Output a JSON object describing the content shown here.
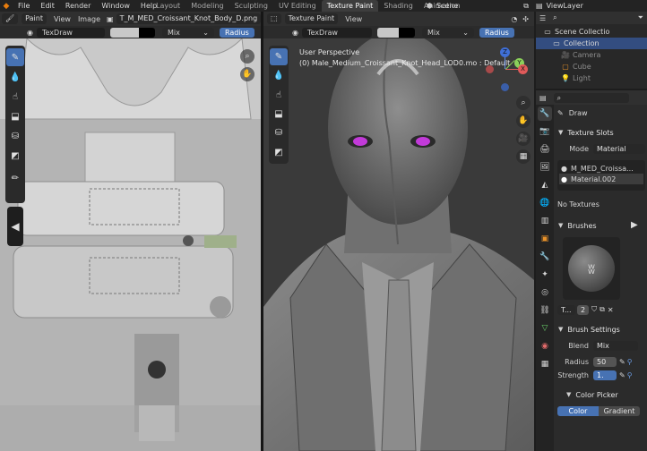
{
  "menubar": {
    "items": [
      "File",
      "Edit",
      "Render",
      "Window",
      "Help"
    ],
    "workspaces": [
      "Layout",
      "Modeling",
      "Sculpting",
      "UV Editing",
      "Texture Paint",
      "Shading",
      "Animation"
    ],
    "active_workspace": "Texture Paint",
    "scene": "Scene",
    "view_layer": "ViewLayer"
  },
  "image_editor": {
    "mode": "Paint",
    "menus": [
      "View",
      "Image"
    ],
    "image_name": "T_M_MED_Croissant_Knot_Body_D.png",
    "texture": "TexDraw",
    "blend": "Mix",
    "radius_label": "Radius"
  },
  "viewport": {
    "mode": "Texture Paint",
    "menus": [
      "View"
    ],
    "texture": "TexDraw",
    "blend": "Mix",
    "radius_label": "Radius",
    "perspective": "User Perspective",
    "object_info": "(0) Male_Medium_Croissant_Knot_Head_LOD0.mo : Default",
    "gizmo": {
      "x": "X",
      "y": "Y",
      "z": "Z"
    }
  },
  "outliner": {
    "items": [
      {
        "label": "Scene Collectio",
        "icon": "collection-icon",
        "indent": 0
      },
      {
        "label": "Collection",
        "icon": "collection-icon",
        "indent": 1,
        "selected": true
      },
      {
        "label": "Camera",
        "icon": "camera-icon",
        "indent": 2,
        "dim": true
      },
      {
        "label": "Cube",
        "icon": "cube-icon",
        "indent": 2,
        "dim": true
      },
      {
        "label": "Light",
        "icon": "light-icon",
        "indent": 2,
        "dim": true
      }
    ]
  },
  "properties": {
    "tool_name": "Draw",
    "texture_slots": {
      "title": "Texture Slots",
      "mode_label": "Mode",
      "mode_value": "Material",
      "slots": [
        "M_MED_Croissa...",
        "Material.002"
      ],
      "no_textures": "No Textures"
    },
    "brushes": {
      "title": "Brushes",
      "brush_name": "T...",
      "users": "2"
    },
    "brush_settings": {
      "title": "Brush Settings",
      "blend_label": "Blend",
      "blend_value": "Mix",
      "radius_label": "Radius",
      "radius_value": "50",
      "strength_label": "Strength",
      "strength_value": "1."
    },
    "color_picker": {
      "title": "Color Picker",
      "tabs": [
        "Color",
        "Gradient"
      ],
      "active_tab": "Color"
    }
  },
  "colors": {
    "accent": "#4772b3",
    "eyes": "#c23ad9",
    "bg": "#1d1d1d"
  }
}
